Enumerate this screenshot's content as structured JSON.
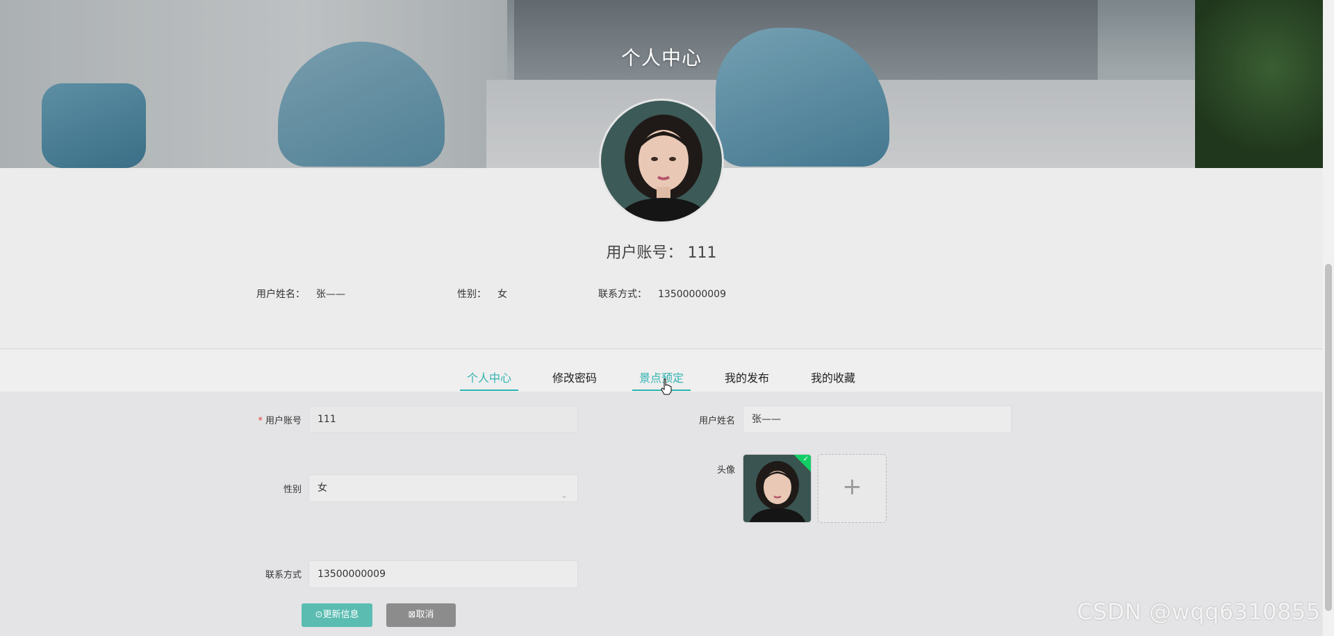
{
  "hero": {
    "title": "个人中心"
  },
  "profile": {
    "account_label": "用户账号：",
    "account_value": "111",
    "info": [
      {
        "label": "用户姓名：",
        "value": "张——"
      },
      {
        "label": "性别：",
        "value": "女"
      },
      {
        "label": "联系方式：",
        "value": "13500000009"
      }
    ]
  },
  "tabs": [
    {
      "label": "个人中心",
      "active": true
    },
    {
      "label": "修改密码",
      "active": false
    },
    {
      "label": "景点预定",
      "active": false
    },
    {
      "label": "我的发布",
      "active": false
    },
    {
      "label": "我的收藏",
      "active": false
    }
  ],
  "form": {
    "account": {
      "label": "用户账号",
      "value": "111"
    },
    "name": {
      "label": "用户姓名",
      "value": "张——"
    },
    "gender": {
      "label": "性别",
      "value": "女"
    },
    "avatar": {
      "label": "头像"
    },
    "phone": {
      "label": "联系方式",
      "value": "13500000009"
    }
  },
  "buttons": {
    "update": "更新信息",
    "cancel": "取消"
  },
  "watermark": "CSDN @wqq6310855",
  "colors": {
    "accent": "#2fb3b0",
    "primary_button": "#5bbcb2",
    "cancel_button": "#8c8c8c",
    "success": "#13ce66"
  }
}
